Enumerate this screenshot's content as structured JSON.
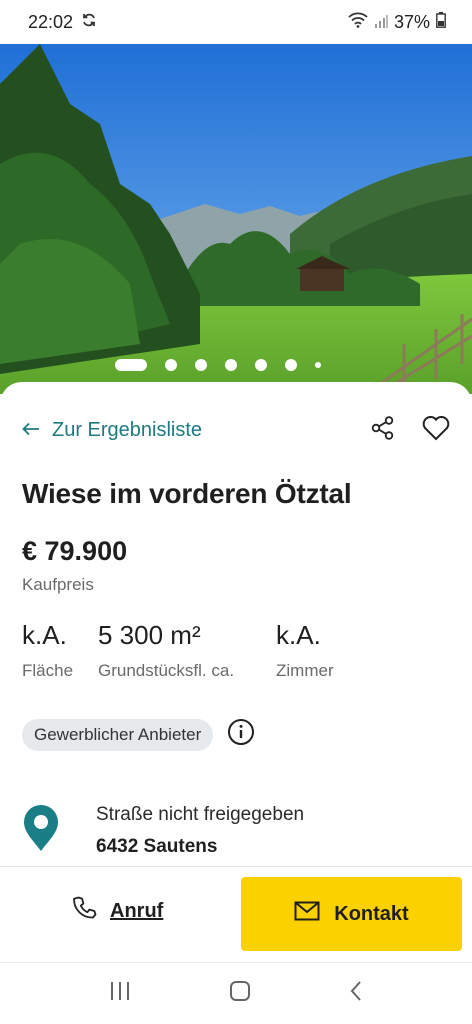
{
  "status": {
    "time": "22:02",
    "battery": "37%"
  },
  "carousel": {
    "count": 7,
    "active_index": 0
  },
  "nav": {
    "back_label": "Zur Ergebnisliste"
  },
  "listing": {
    "title": "Wiese im vorderen Ötztal",
    "price": "€ 79.900",
    "price_label": "Kaufpreis",
    "facts": [
      {
        "value": "k.A.",
        "label": "Fläche"
      },
      {
        "value": "5 300 m²",
        "label": "Grundstücksfl. ca."
      },
      {
        "value": "k.A.",
        "label": "Zimmer"
      }
    ],
    "seller_badge": "Gewerblicher Anbieter",
    "location": {
      "street": "Straße nicht freigegeben",
      "city": "6432 Sautens"
    }
  },
  "actions": {
    "call_label": "Anruf",
    "contact_label": "Kontakt"
  },
  "colors": {
    "accent": "#1d7b80",
    "contact_button": "#fcd100",
    "pin": "#1a7e86"
  }
}
